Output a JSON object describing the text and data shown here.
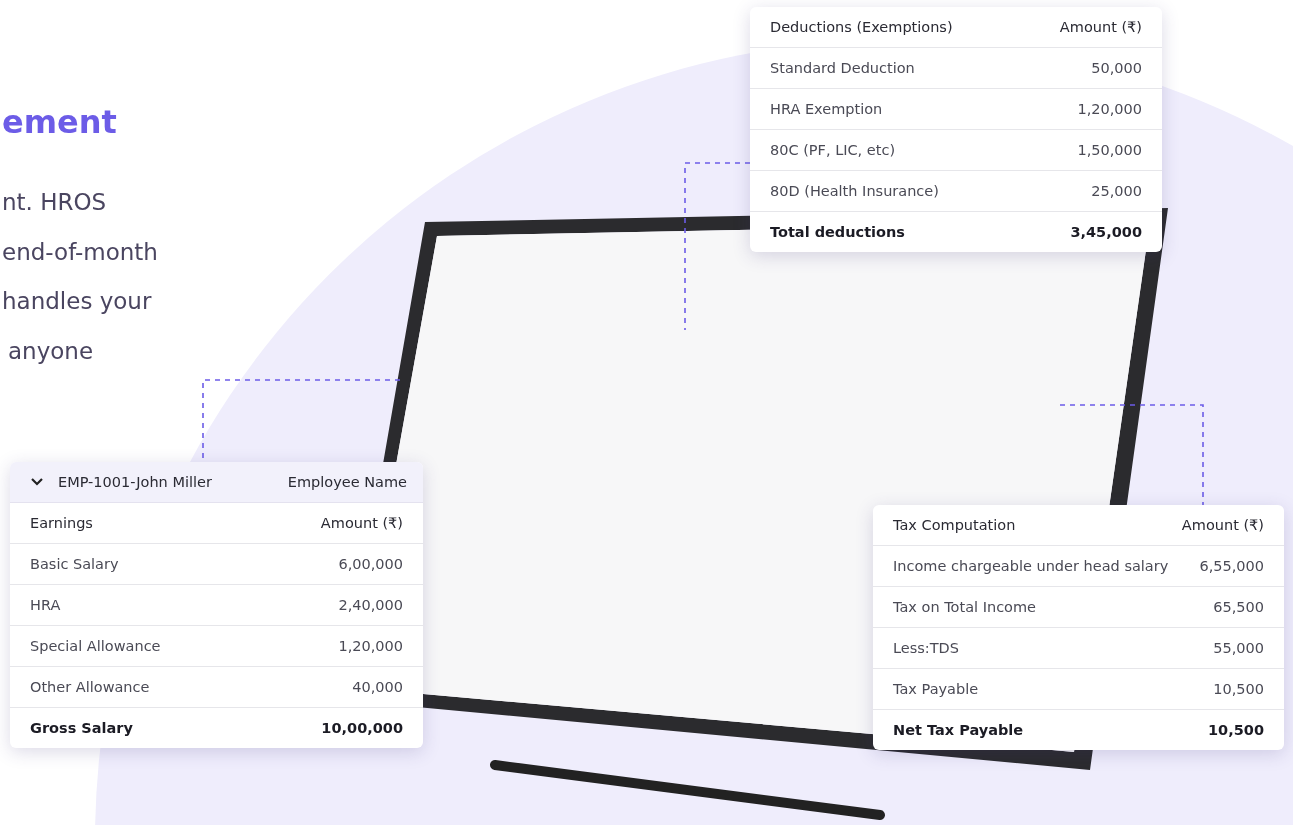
{
  "hero": {
    "heading": "ement",
    "lines": [
      "nt. HROS",
      "end-of-month",
      "handles your",
      "anyone"
    ]
  },
  "cards": [
    {
      "columns": [
        "Deductions (Exemptions)",
        "Amount (₹)"
      ],
      "rows": [
        {
          "label": "Standard Deduction",
          "amount": "50,000",
          "total": false
        },
        {
          "label": "HRA Exemption",
          "amount": "1,20,000",
          "total": false
        },
        {
          "label": "80C (PF, LIC, etc)",
          "amount": "1,50,000",
          "total": false
        },
        {
          "label": "80D (Health Insurance)",
          "amount": "25,000",
          "total": false
        },
        {
          "label": "Total deductions",
          "amount": "3,45,000",
          "total": true
        }
      ]
    },
    {
      "header": {
        "employee": "EMP-1001-John Miller",
        "label": "Employee Name",
        "expanded": true
      },
      "columns": [
        "Earnings",
        "Amount (₹)"
      ],
      "rows": [
        {
          "label": "Basic Salary",
          "amount": "6,00,000",
          "total": false
        },
        {
          "label": "HRA",
          "amount": "2,40,000",
          "total": false
        },
        {
          "label": "Special Allowance",
          "amount": "1,20,000",
          "total": false
        },
        {
          "label": "Other Allowance",
          "amount": "40,000",
          "total": false
        },
        {
          "label": "Gross Salary",
          "amount": "10,00,000",
          "total": true
        }
      ]
    },
    {
      "columns": [
        "Tax Computation",
        "Amount (₹)"
      ],
      "rows": [
        {
          "label": "Income chargeable under head salary",
          "amount": "6,55,000",
          "total": false
        },
        {
          "label": "Tax on Total Income",
          "amount": "65,500",
          "total": false
        },
        {
          "label": "Less:TDS",
          "amount": "55,000",
          "total": false
        },
        {
          "label": "Tax Payable",
          "amount": "10,500",
          "total": false
        },
        {
          "label": "Net Tax Payable",
          "amount": "10,500",
          "total": true
        }
      ]
    }
  ]
}
